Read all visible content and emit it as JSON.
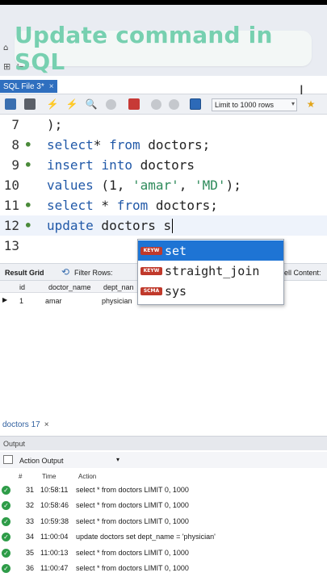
{
  "banner": {
    "title": "Update command in SQL"
  },
  "file_tab": {
    "label": "SQL File 3*",
    "close": "×"
  },
  "toolbar": {
    "limit_label": "Limit to 1000 rows",
    "limit_dropdown": "▾"
  },
  "editor": {
    "lines": [
      {
        "num": "7",
        "dot": "",
        "parts": [
          {
            "t": ");",
            "c": ""
          }
        ]
      },
      {
        "num": "8",
        "dot": "•",
        "parts": [
          {
            "t": "select",
            "c": "kw"
          },
          {
            "t": "* ",
            "c": ""
          },
          {
            "t": "from",
            "c": "kw"
          },
          {
            "t": " doctors;",
            "c": ""
          }
        ]
      },
      {
        "num": "9",
        "dot": "•",
        "parts": [
          {
            "t": "insert",
            "c": "kw"
          },
          {
            "t": " ",
            "c": ""
          },
          {
            "t": "into",
            "c": "kw"
          },
          {
            "t": " doctors",
            "c": ""
          }
        ]
      },
      {
        "num": "10",
        "dot": "",
        "parts": [
          {
            "t": "values",
            "c": "kw"
          },
          {
            "t": " (1, ",
            "c": ""
          },
          {
            "t": "'amar'",
            "c": "str"
          },
          {
            "t": ", ",
            "c": ""
          },
          {
            "t": "'MD'",
            "c": "str"
          },
          {
            "t": ");",
            "c": ""
          }
        ]
      },
      {
        "num": "11",
        "dot": "•",
        "parts": [
          {
            "t": "select",
            "c": "kw"
          },
          {
            "t": " * ",
            "c": ""
          },
          {
            "t": "from",
            "c": "kw"
          },
          {
            "t": " doctors;",
            "c": ""
          }
        ]
      },
      {
        "num": "12",
        "dot": "•",
        "parts": [
          {
            "t": "update",
            "c": "kw"
          },
          {
            "t": " doctors s",
            "c": ""
          }
        ]
      },
      {
        "num": "13",
        "dot": "",
        "parts": []
      }
    ],
    "current_line": 5
  },
  "autocomplete": {
    "items": [
      {
        "badge": "KEYW",
        "label": "set",
        "selected": true
      },
      {
        "badge": "KEYW",
        "label": "straight_join",
        "selected": false
      },
      {
        "badge": "SCMA",
        "label": "sys",
        "selected": false
      }
    ]
  },
  "result_bar": {
    "grid_label": "Result Grid",
    "filter_label": "Filter Rows:",
    "cell_content": "ell Content:"
  },
  "grid": {
    "columns": [
      "id",
      "doctor_name",
      "dept_nan"
    ],
    "rows": [
      [
        "1",
        "amar",
        "physician"
      ]
    ],
    "row_pointer": "▶"
  },
  "doc_tab": {
    "label": "doctors 17",
    "close": "×"
  },
  "output": {
    "label": "Output",
    "action_output_label": "Action Output",
    "dropdown": "▾"
  },
  "log": {
    "columns": [
      "#",
      "Time",
      "Action"
    ],
    "check": "✓",
    "rows": [
      {
        "num": "31",
        "time": "10:58:11",
        "action": "select * from doctors LIMIT 0, 1000"
      },
      {
        "num": "32",
        "time": "10:58:46",
        "action": "select * from doctors LIMIT 0, 1000"
      },
      {
        "num": "33",
        "time": "10:59:38",
        "action": "select * from doctors LIMIT 0, 1000"
      },
      {
        "num": "34",
        "time": "11:00:04",
        "action": "update doctors set dept_name = 'physician'"
      },
      {
        "num": "35",
        "time": "11:00:13",
        "action": "select * from doctors LIMIT 0, 1000"
      },
      {
        "num": "36",
        "time": "11:00:47",
        "action": "select * from doctors LIMIT 0, 1000"
      }
    ]
  },
  "colors": {
    "accent_teal": "#77d0b0",
    "selection_blue": "#1e74d4",
    "keyword_blue": "#2159a8",
    "success_green": "#2e9c48"
  }
}
